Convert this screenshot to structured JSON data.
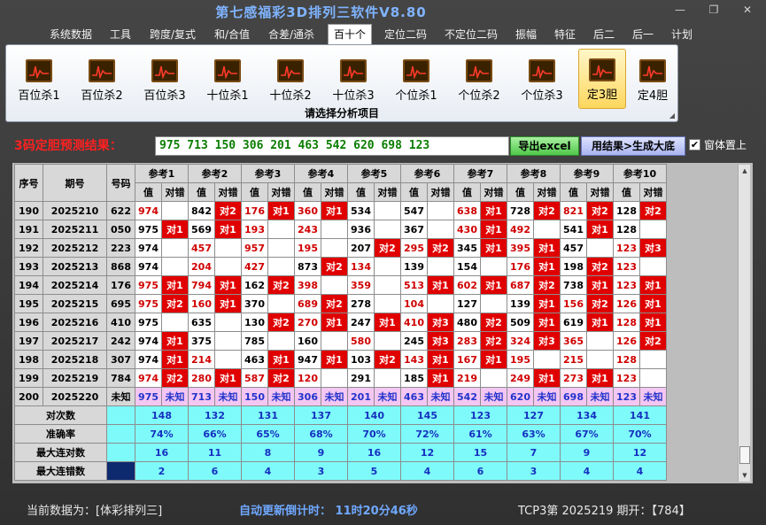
{
  "window": {
    "title": "第七感福彩3D排列三软件V8.80"
  },
  "menu": [
    "系统数据",
    "工具",
    "跨度/复式",
    "和/合值",
    "合差/通杀",
    "百十个",
    "定位二码",
    "不定位二码",
    "振幅",
    "特征",
    "后二",
    "后一",
    "计划"
  ],
  "active_menu_index": 5,
  "ribbon": {
    "buttons": [
      "百位杀1",
      "百位杀2",
      "百位杀3",
      "十位杀1",
      "十位杀2",
      "十位杀3",
      "个位杀1",
      "个位杀2",
      "个位杀3",
      "定3胆",
      "定4胆"
    ],
    "active_index": 9,
    "caption": "请选择分析项目"
  },
  "prediction": {
    "label": "3码定胆预测结果：",
    "value": "975 713 150 306 201 463 542 620 698 123",
    "excel_button": "导出excel",
    "generate_button": "用结果>生成大底",
    "stay_on_top_label": "窗体置上",
    "stay_on_top_checked": true
  },
  "table": {
    "headers": {
      "seq": "序号",
      "period": "期号",
      "number": "号码",
      "ref_prefix": "参考",
      "val": "值",
      "check": "对错"
    },
    "rows": [
      {
        "seq": "190",
        "period": "2025210",
        "num": "622",
        "cells": [
          [
            "974",
            ""
          ],
          [
            "842",
            "对2"
          ],
          [
            "176",
            "对1"
          ],
          [
            "360",
            "对1"
          ],
          [
            "534",
            ""
          ],
          [
            "547",
            ""
          ],
          [
            "638",
            "对1"
          ],
          [
            "728",
            "对2"
          ],
          [
            "821",
            "对2"
          ],
          [
            "128",
            "对2"
          ]
        ]
      },
      {
        "seq": "191",
        "period": "2025211",
        "num": "050",
        "cells": [
          [
            "975",
            "对1"
          ],
          [
            "569",
            "对1"
          ],
          [
            "193",
            ""
          ],
          [
            "243",
            ""
          ],
          [
            "936",
            ""
          ],
          [
            "367",
            ""
          ],
          [
            "430",
            "对1"
          ],
          [
            "492",
            ""
          ],
          [
            "541",
            "对1"
          ],
          [
            "128",
            ""
          ]
        ]
      },
      {
        "seq": "192",
        "period": "2025212",
        "num": "223",
        "cells": [
          [
            "974",
            ""
          ],
          [
            "457",
            ""
          ],
          [
            "957",
            ""
          ],
          [
            "195",
            ""
          ],
          [
            "207",
            "对2"
          ],
          [
            "295",
            "对2"
          ],
          [
            "345",
            "对1"
          ],
          [
            "395",
            "对1"
          ],
          [
            "457",
            ""
          ],
          [
            "123",
            "对3"
          ]
        ]
      },
      {
        "seq": "193",
        "period": "2025213",
        "num": "868",
        "cells": [
          [
            "974",
            ""
          ],
          [
            "204",
            ""
          ],
          [
            "427",
            ""
          ],
          [
            "873",
            "对2"
          ],
          [
            "134",
            ""
          ],
          [
            "139",
            ""
          ],
          [
            "154",
            ""
          ],
          [
            "176",
            "对1"
          ],
          [
            "198",
            "对2"
          ],
          [
            "123",
            ""
          ]
        ]
      },
      {
        "seq": "194",
        "period": "2025214",
        "num": "176",
        "cells": [
          [
            "975",
            "对1"
          ],
          [
            "794",
            "对1"
          ],
          [
            "162",
            "对2"
          ],
          [
            "398",
            ""
          ],
          [
            "359",
            ""
          ],
          [
            "513",
            "对1"
          ],
          [
            "602",
            "对1"
          ],
          [
            "687",
            "对2"
          ],
          [
            "738",
            "对1"
          ],
          [
            "123",
            "对1"
          ]
        ]
      },
      {
        "seq": "195",
        "period": "2025215",
        "num": "695",
        "cells": [
          [
            "975",
            "对2"
          ],
          [
            "160",
            "对1"
          ],
          [
            "370",
            ""
          ],
          [
            "689",
            "对2"
          ],
          [
            "278",
            ""
          ],
          [
            "104",
            ""
          ],
          [
            "127",
            ""
          ],
          [
            "139",
            "对1"
          ],
          [
            "156",
            "对2"
          ],
          [
            "126",
            "对1"
          ]
        ]
      },
      {
        "seq": "196",
        "period": "2025216",
        "num": "410",
        "cells": [
          [
            "975",
            ""
          ],
          [
            "635",
            ""
          ],
          [
            "130",
            "对2"
          ],
          [
            "270",
            "对1"
          ],
          [
            "247",
            "对1"
          ],
          [
            "410",
            "对3"
          ],
          [
            "480",
            "对2"
          ],
          [
            "509",
            "对1"
          ],
          [
            "619",
            "对1"
          ],
          [
            "128",
            "对1"
          ]
        ]
      },
      {
        "seq": "197",
        "period": "2025217",
        "num": "242",
        "cells": [
          [
            "974",
            "对1"
          ],
          [
            "375",
            ""
          ],
          [
            "785",
            ""
          ],
          [
            "160",
            ""
          ],
          [
            "580",
            ""
          ],
          [
            "245",
            "对3"
          ],
          [
            "283",
            "对2"
          ],
          [
            "324",
            "对3"
          ],
          [
            "365",
            ""
          ],
          [
            "126",
            "对2"
          ]
        ]
      },
      {
        "seq": "198",
        "period": "2025218",
        "num": "307",
        "cells": [
          [
            "974",
            "对1"
          ],
          [
            "214",
            ""
          ],
          [
            "463",
            "对1"
          ],
          [
            "947",
            "对1"
          ],
          [
            "103",
            "对2"
          ],
          [
            "143",
            "对1"
          ],
          [
            "167",
            "对1"
          ],
          [
            "195",
            ""
          ],
          [
            "215",
            ""
          ],
          [
            "128",
            ""
          ]
        ]
      },
      {
        "seq": "199",
        "period": "2025219",
        "num": "784",
        "cells": [
          [
            "974",
            "对2"
          ],
          [
            "280",
            "对1"
          ],
          [
            "587",
            "对2"
          ],
          [
            "120",
            ""
          ],
          [
            "291",
            ""
          ],
          [
            "185",
            "对1"
          ],
          [
            "219",
            ""
          ],
          [
            "249",
            "对1"
          ],
          [
            "273",
            "对1"
          ],
          [
            "123",
            ""
          ]
        ]
      }
    ],
    "red_values": [
      [
        0,
        4,
        5,
        9
      ],
      [
        2,
        3,
        4,
        5,
        8,
        9
      ],
      [
        0,
        1,
        2,
        3,
        9
      ],
      [
        0,
        1,
        2,
        4,
        5,
        6,
        9
      ],
      [
        3,
        4,
        7
      ],
      [
        2,
        4,
        5,
        6,
        8
      ],
      [
        0,
        1,
        4,
        7,
        8,
        9
      ],
      [
        1,
        2,
        3,
        4,
        7,
        8,
        9
      ],
      [
        0,
        5,
        7,
        8,
        9
      ],
      [
        2,
        3,
        4,
        5,
        6,
        7,
        8,
        9
      ]
    ],
    "pending": {
      "seq": "200",
      "period": "2025220",
      "num": "未知",
      "cells": [
        [
          "975",
          "未知"
        ],
        [
          "713",
          "未知"
        ],
        [
          "150",
          "未知"
        ],
        [
          "306",
          "未知"
        ],
        [
          "201",
          "未知"
        ],
        [
          "463",
          "未知"
        ],
        [
          "542",
          "未知"
        ],
        [
          "620",
          "未知"
        ],
        [
          "698",
          "未知"
        ],
        [
          "123",
          "未知"
        ]
      ]
    },
    "stats": [
      {
        "label": "对次数",
        "values": [
          "148",
          "132",
          "131",
          "137",
          "140",
          "145",
          "123",
          "127",
          "134",
          "141"
        ]
      },
      {
        "label": "准确率",
        "values": [
          "74%",
          "66%",
          "65%",
          "68%",
          "70%",
          "72%",
          "61%",
          "63%",
          "67%",
          "70%"
        ]
      },
      {
        "label": "最大连对数",
        "values": [
          "16",
          "11",
          "8",
          "9",
          "16",
          "12",
          "15",
          "7",
          "9",
          "12"
        ]
      },
      {
        "label": "最大连错数",
        "values": [
          "2",
          "6",
          "4",
          "3",
          "5",
          "4",
          "6",
          "3",
          "4",
          "4"
        ]
      }
    ]
  },
  "status": {
    "data_source": "当前数据为：[体彩排列三]",
    "countdown": "自动更新倒计时：  11时20分46秒",
    "tcp": "TCP3第 2025219 期开：【784】"
  },
  "colors": {
    "hit": "#e00000",
    "pending": "#f4c6f2",
    "stats": "#7ffafa",
    "prediction_text": "#0a7d00",
    "title": "#7fb4ff"
  }
}
